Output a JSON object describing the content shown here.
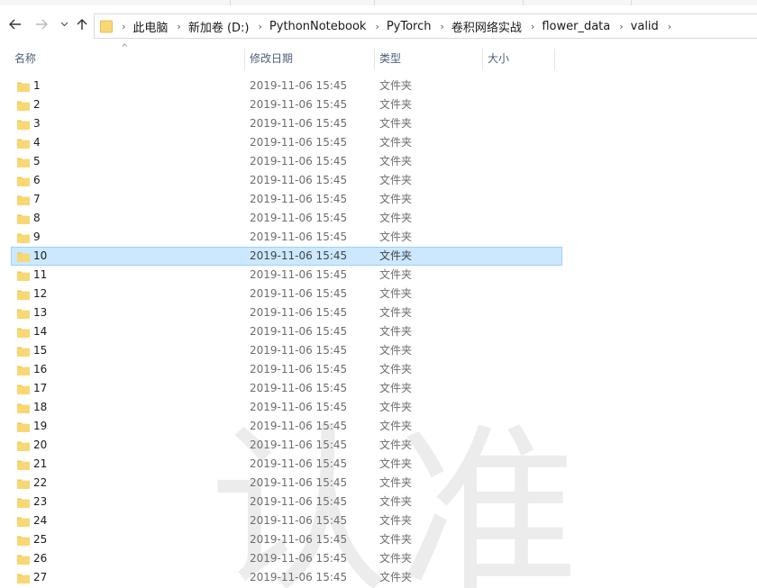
{
  "breadcrumb": [
    "此电脑",
    "新加卷 (D:)",
    "PythonNotebook",
    "PyTorch",
    "卷积网络实战",
    "flower_data",
    "valid"
  ],
  "columns": {
    "name": "名称",
    "date": "修改日期",
    "type": "类型",
    "size": "大小"
  },
  "selected_index": 9,
  "rows": [
    {
      "name": "1",
      "date": "2019-11-06 15:45",
      "type": "文件夹"
    },
    {
      "name": "2",
      "date": "2019-11-06 15:45",
      "type": "文件夹"
    },
    {
      "name": "3",
      "date": "2019-11-06 15:45",
      "type": "文件夹"
    },
    {
      "name": "4",
      "date": "2019-11-06 15:45",
      "type": "文件夹"
    },
    {
      "name": "5",
      "date": "2019-11-06 15:45",
      "type": "文件夹"
    },
    {
      "name": "6",
      "date": "2019-11-06 15:45",
      "type": "文件夹"
    },
    {
      "name": "7",
      "date": "2019-11-06 15:45",
      "type": "文件夹"
    },
    {
      "name": "8",
      "date": "2019-11-06 15:45",
      "type": "文件夹"
    },
    {
      "name": "9",
      "date": "2019-11-06 15:45",
      "type": "文件夹"
    },
    {
      "name": "10",
      "date": "2019-11-06 15:45",
      "type": "文件夹"
    },
    {
      "name": "11",
      "date": "2019-11-06 15:45",
      "type": "文件夹"
    },
    {
      "name": "12",
      "date": "2019-11-06 15:45",
      "type": "文件夹"
    },
    {
      "name": "13",
      "date": "2019-11-06 15:45",
      "type": "文件夹"
    },
    {
      "name": "14",
      "date": "2019-11-06 15:45",
      "type": "文件夹"
    },
    {
      "name": "15",
      "date": "2019-11-06 15:45",
      "type": "文件夹"
    },
    {
      "name": "16",
      "date": "2019-11-06 15:45",
      "type": "文件夹"
    },
    {
      "name": "17",
      "date": "2019-11-06 15:45",
      "type": "文件夹"
    },
    {
      "name": "18",
      "date": "2019-11-06 15:45",
      "type": "文件夹"
    },
    {
      "name": "19",
      "date": "2019-11-06 15:45",
      "type": "文件夹"
    },
    {
      "name": "20",
      "date": "2019-11-06 15:45",
      "type": "文件夹"
    },
    {
      "name": "21",
      "date": "2019-11-06 15:45",
      "type": "文件夹"
    },
    {
      "name": "22",
      "date": "2019-11-06 15:45",
      "type": "文件夹"
    },
    {
      "name": "23",
      "date": "2019-11-06 15:45",
      "type": "文件夹"
    },
    {
      "name": "24",
      "date": "2019-11-06 15:45",
      "type": "文件夹"
    },
    {
      "name": "25",
      "date": "2019-11-06 15:45",
      "type": "文件夹"
    },
    {
      "name": "26",
      "date": "2019-11-06 15:45",
      "type": "文件夹"
    },
    {
      "name": "27",
      "date": "2019-11-06 15:45",
      "type": "文件夹"
    }
  ],
  "icons": {
    "back": "back-arrow-icon",
    "forward": "forward-arrow-icon",
    "recent": "chevron-down-icon",
    "up": "up-arrow-icon",
    "folder": "folder-icon"
  },
  "colors": {
    "selected_bg": "#cce8ff",
    "selected_border": "#99d1ff",
    "folder": "#f8d775",
    "header_text": "#4c607a"
  }
}
